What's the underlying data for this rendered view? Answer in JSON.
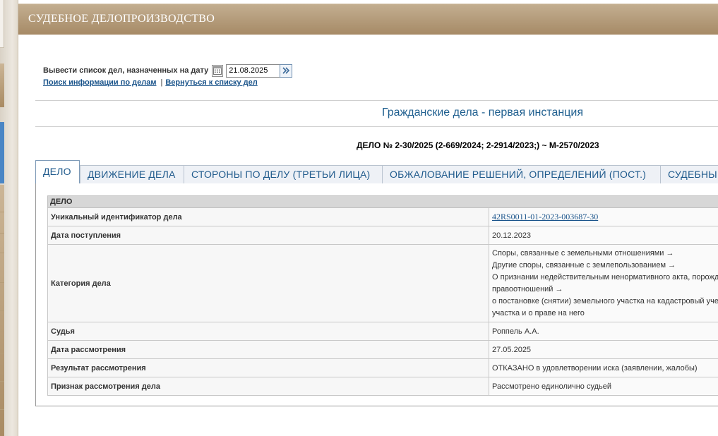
{
  "header": {
    "title": "СУДЕБНОЕ ДЕЛОПРОИЗВОДСТВО"
  },
  "date_filter": {
    "label": "Вывести список дел, назначенных на дату",
    "value": "21.08.2025"
  },
  "links": {
    "search": "Поиск информации по делам",
    "separator": "|",
    "back": "Вернуться к списку дел"
  },
  "section_title": "Гражданские дела - первая инстанция",
  "case_number": "ДЕЛО № 2-30/2025 (2-669/2024; 2-2914/2023;) ~ М-2570/2023",
  "tabs": [
    {
      "label": "ДЕЛО",
      "active": true
    },
    {
      "label": "ДВИЖЕНИЕ ДЕЛА",
      "active": false
    },
    {
      "label": "СТОРОНЫ ПО ДЕЛУ (ТРЕТЬИ ЛИЦА)",
      "active": false
    },
    {
      "label": "ОБЖАЛОВАНИЕ РЕШЕНИЙ, ОПРЕДЕЛЕНИЙ (ПОСТ.)",
      "active": false
    },
    {
      "label": "СУДЕБНЫ",
      "active": false
    }
  ],
  "case_table": {
    "heading": "ДЕЛО",
    "rows": {
      "uid": {
        "label": "Уникальный идентификатор дела",
        "value": "42RS0011-01-2023-003687-30"
      },
      "received": {
        "label": "Дата поступления",
        "value": "20.12.2023"
      },
      "category": {
        "label": "Категория дела",
        "lines": [
          "Споры, связанные с земельными отношениями →",
          "Другие споры, связанные с землепользованием →",
          "О признании недействительным ненормативного акта, порожд",
          "правоотношений →",
          "о постановке (снятии) земельного участка на кадастровый уче",
          "участка и о праве на него"
        ]
      },
      "judge": {
        "label": "Судья",
        "value": "Роппель А.А."
      },
      "review_date": {
        "label": "Дата рассмотрения",
        "value": "27.05.2025"
      },
      "result": {
        "label": "Результат рассмотрения",
        "value": "ОТКАЗАНО в удовлетворении иска (заявлении, жалобы)"
      },
      "review_sign": {
        "label": "Признак рассмотрения дела",
        "value": "Рассмотрено единолично судьей"
      }
    }
  }
}
